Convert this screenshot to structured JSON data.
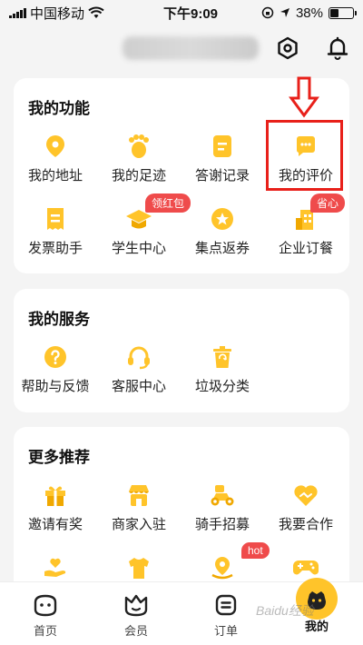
{
  "status": {
    "carrier": "中国移动",
    "time": "下午9:09",
    "battery": "38%",
    "battery_level": 0.38
  },
  "header": {
    "settings_icon": "hexagon-settings-icon",
    "notify_icon": "bell-icon"
  },
  "my_functions": {
    "title": "我的功能",
    "items": [
      {
        "label": "我的地址",
        "icon": "location-pin-icon"
      },
      {
        "label": "我的足迹",
        "icon": "footprint-icon"
      },
      {
        "label": "答谢记录",
        "icon": "document-icon"
      },
      {
        "label": "我的评价",
        "icon": "comment-bubble-icon"
      },
      {
        "label": "发票助手",
        "icon": "invoice-icon",
        "badge": ""
      },
      {
        "label": "学生中心",
        "icon": "graduation-cap-icon",
        "badge": "领红包"
      },
      {
        "label": "集点返券",
        "icon": "star-coin-icon"
      },
      {
        "label": "企业订餐",
        "icon": "building-icon",
        "badge": "省心"
      }
    ]
  },
  "my_services": {
    "title": "我的服务",
    "items": [
      {
        "label": "帮助与反馈",
        "icon": "help-icon"
      },
      {
        "label": "客服中心",
        "icon": "headset-icon"
      },
      {
        "label": "垃圾分类",
        "icon": "trash-icon"
      }
    ]
  },
  "more": {
    "title": "更多推荐",
    "items": [
      {
        "label": "邀请有奖",
        "icon": "gift-icon"
      },
      {
        "label": "商家入驻",
        "icon": "store-icon"
      },
      {
        "label": "骑手招募",
        "icon": "scooter-icon"
      },
      {
        "label": "我要合作",
        "icon": "handshake-heart-icon"
      }
    ],
    "row2_badge": "hot"
  },
  "tabs": [
    {
      "label": "首页",
      "icon": "home-face-icon"
    },
    {
      "label": "会员",
      "icon": "crown-face-icon"
    },
    {
      "label": "订单",
      "icon": "order-list-icon"
    },
    {
      "label": "我的",
      "icon": "my-face-icon"
    }
  ],
  "watermark": "Baidu经验",
  "colors": {
    "accent": "#ffc42a",
    "badge": "#ef4b4b",
    "highlight": "#e8201a"
  }
}
